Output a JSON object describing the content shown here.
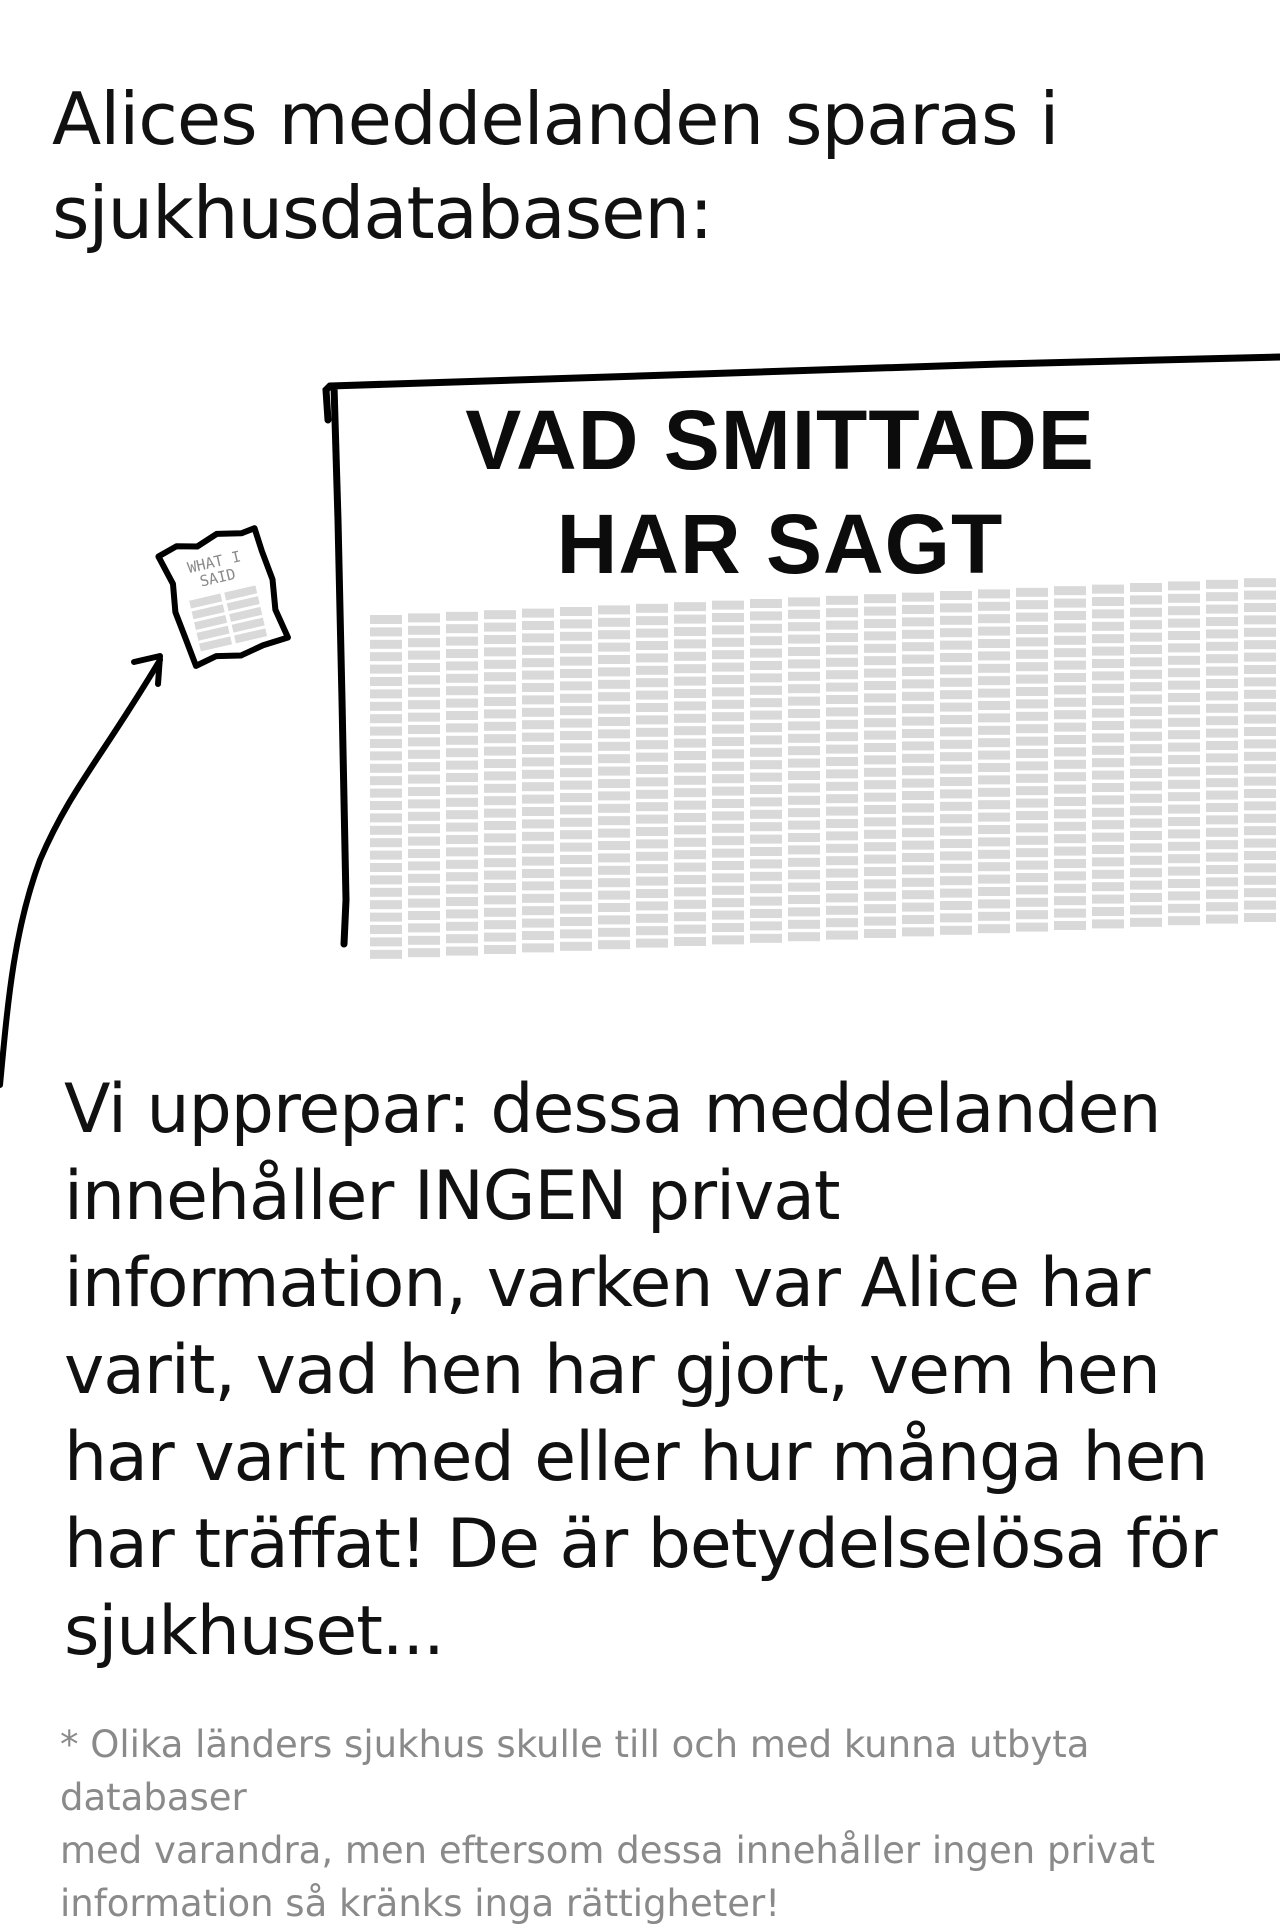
{
  "heading": {
    "lines": [
      "Alices meddelanden sparas i",
      "sjukhusdatabasen:"
    ]
  },
  "database": {
    "title_lines": [
      "VAD SMITTADE",
      "HAR SAGT"
    ],
    "cell_color": "#d9d9d9",
    "frame_color": "#000000"
  },
  "document": {
    "label_lines": [
      "WHAT I",
      "SAID"
    ],
    "cell_color": "#d9d9d9"
  },
  "body": {
    "lines": [
      "Vi upprepar: dessa meddelanden",
      "innehåller INGEN privat",
      "information, varken var Alice har",
      "varit, vad hen har gjort, vem hen",
      "har varit med eller hur många hen",
      "har träffat! De är betydelselösa för",
      "sjukhuset..."
    ]
  },
  "footnote": {
    "lines": [
      "* Olika länders sjukhus skulle till och med kunna utbyta databaser",
      "med varandra, men eftersom dessa innehåller ingen privat",
      "information så kränks inga rättigheter!"
    ],
    "color": "#8a8a8a"
  },
  "icons": [
    "arrow-icon",
    "document-icon",
    "database-frame"
  ]
}
